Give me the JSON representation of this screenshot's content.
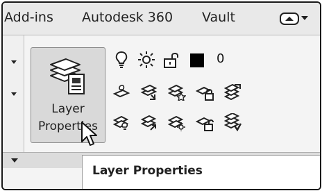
{
  "ribbon_tabs": [
    "Add-ins",
    "Autodesk 360",
    "Vault"
  ],
  "tab_menu_icon": "minimize-ribbon-icon",
  "layer_button": {
    "label_line1": "Layer",
    "label_line2": "Properties",
    "icon": "layer-properties-icon"
  },
  "layer_control": {
    "current_layer": "0",
    "icons": [
      "lightbulb-on-icon",
      "sun-thaw-icon",
      "unlock-icon"
    ],
    "color": "#000000"
  },
  "tool_rows": [
    [
      "layer-off-icon",
      "layer-match-icon",
      "layer-isolate-icon",
      "layer-lock-icon",
      "layer-walk-icon"
    ],
    [
      "layer-on-icon",
      "make-current-icon",
      "layer-freeze-icon",
      "layer-unlock-icon",
      "copy-layer-icon"
    ]
  ],
  "tooltip": {
    "title": "Layer Properties"
  },
  "cursor": "arrow-cursor-icon"
}
